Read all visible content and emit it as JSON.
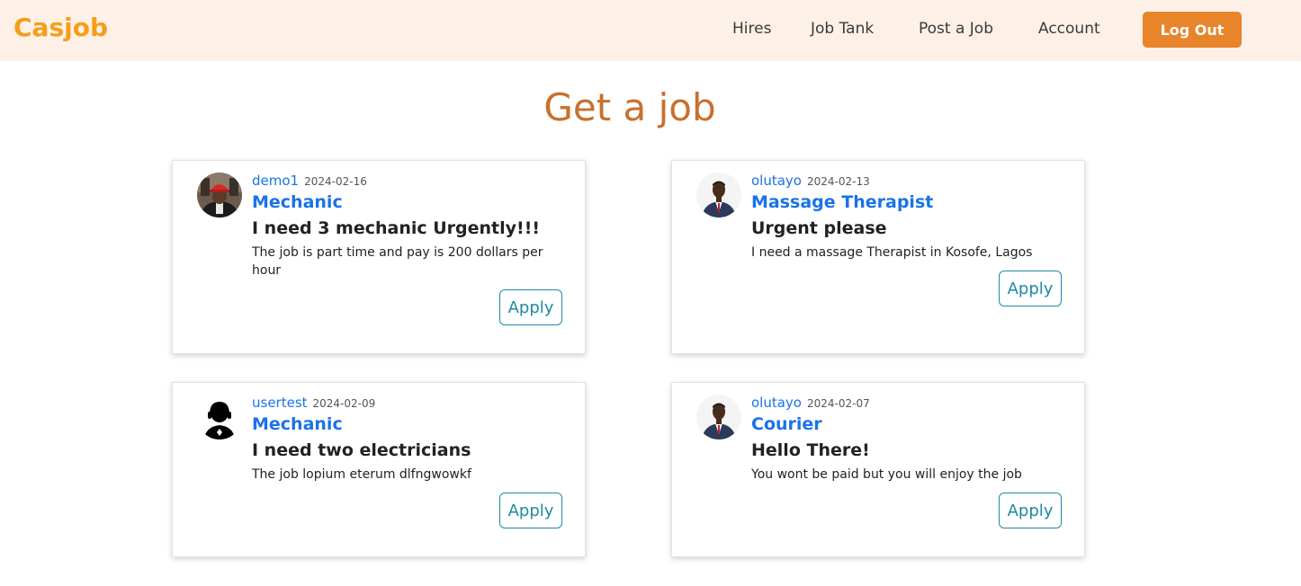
{
  "brand": "Casjob",
  "nav": {
    "hires": "Hires",
    "job_tank": "Job Tank",
    "post_job": "Post a Job",
    "account": "Account",
    "logout": "Log Out"
  },
  "page_title": "Get a job",
  "jobs": [
    {
      "username": "demo1",
      "date": "2024-02-16",
      "category": "Mechanic",
      "title": "I need 3 mechanic Urgently!!!",
      "description": "The job is part time and pay is 200 dollars per hour",
      "apply_label": "Apply",
      "avatar_icon": "photo-avatar-red-helmet"
    },
    {
      "username": "olutayo",
      "date": "2024-02-13",
      "category": "Massage Therapist",
      "title": "Urgent please",
      "description": "I need a massage Therapist in Kosofe, Lagos",
      "apply_label": "Apply",
      "avatar_icon": "photo-avatar-suit"
    },
    {
      "username": "usertest",
      "date": "2024-02-09",
      "category": "Mechanic",
      "title": "I need two electricians",
      "description": "The job lopium eterum dlfngwowkf",
      "apply_label": "Apply",
      "avatar_icon": "user-silhouette-icon"
    },
    {
      "username": "olutayo",
      "date": "2024-02-07",
      "category": "Courier",
      "title": "Hello There!",
      "description": "You wont be paid but you will enjoy the job",
      "apply_label": "Apply",
      "avatar_icon": "photo-avatar-suit"
    }
  ],
  "colors": {
    "brand": "#f59e1b",
    "navbar_bg": "#fdf1e7",
    "logout_bg": "#e8842a",
    "title": "#c8702e",
    "link_blue": "#1a73e8",
    "apply_teal": "#1f8aa3"
  }
}
